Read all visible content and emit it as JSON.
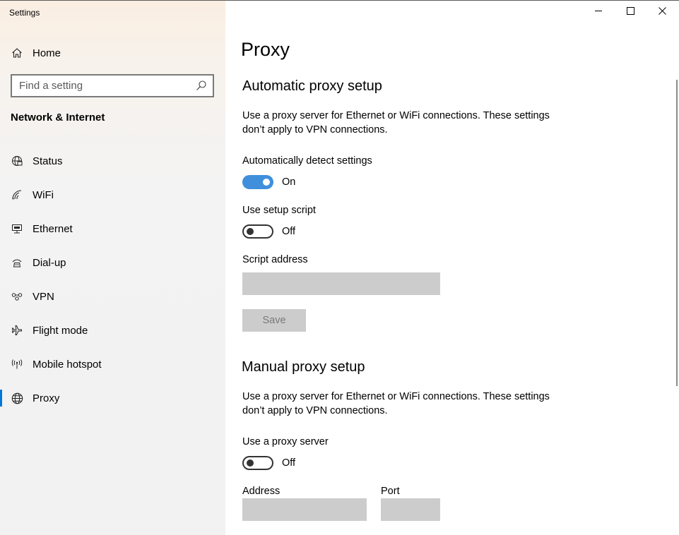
{
  "window": {
    "title": "Settings",
    "controls": [
      "minimize-icon",
      "maximize-icon",
      "close-icon"
    ]
  },
  "sidebar": {
    "home_label": "Home",
    "search_placeholder": "Find a setting",
    "section_title": "Network & Internet",
    "items": [
      {
        "label": "Status",
        "icon": "globe-status-icon",
        "selected": false
      },
      {
        "label": "WiFi",
        "icon": "wifi-icon",
        "selected": false
      },
      {
        "label": "Ethernet",
        "icon": "ethernet-icon",
        "selected": false
      },
      {
        "label": "Dial-up",
        "icon": "dialup-icon",
        "selected": false
      },
      {
        "label": "VPN",
        "icon": "vpn-icon",
        "selected": false
      },
      {
        "label": "Flight mode",
        "icon": "airplane-icon",
        "selected": false
      },
      {
        "label": "Mobile hotspot",
        "icon": "hotspot-icon",
        "selected": false
      },
      {
        "label": "Proxy",
        "icon": "globe-icon",
        "selected": true
      }
    ],
    "accent_color": "#0078d7"
  },
  "main": {
    "title": "Proxy",
    "automatic": {
      "heading": "Automatic proxy setup",
      "description": "Use a proxy server for Ethernet or WiFi connections. These settings don’t apply to VPN connections.",
      "auto_detect_label": "Automatically detect settings",
      "auto_detect_state": "On",
      "setup_script_label": "Use setup script",
      "setup_script_state": "Off",
      "script_address_label": "Script address",
      "script_address_value": "",
      "save_label": "Save"
    },
    "manual": {
      "heading": "Manual proxy setup",
      "description": "Use a proxy server for Ethernet or WiFi connections. These settings don’t apply to VPN connections.",
      "use_proxy_label": "Use a proxy server",
      "use_proxy_state": "Off",
      "address_label": "Address",
      "address_value": "",
      "port_label": "Port",
      "port_value": ""
    },
    "toggle_on_color": "#3f8fdc"
  }
}
